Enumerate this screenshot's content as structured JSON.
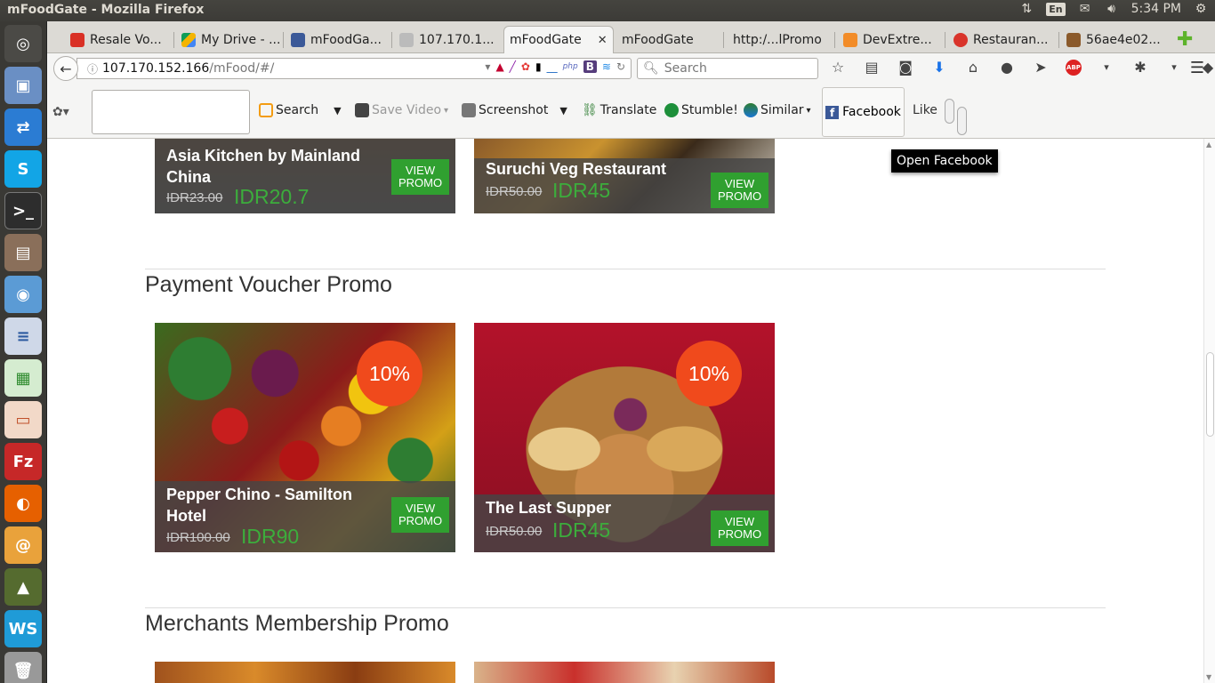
{
  "os": {
    "window_title": "mFoodGate - Mozilla Firefox",
    "lang": "En",
    "time": "5:34 PM"
  },
  "tabs": [
    {
      "label": "Resale Vo...",
      "color": "#d93025"
    },
    {
      "label": "My Drive - ...",
      "color": "#f4b400"
    },
    {
      "label": "mFoodGa...",
      "color": "#3b5998"
    },
    {
      "label": "107.170.1...",
      "color": "#6b6b6b"
    },
    {
      "label": "mFoodGate",
      "active": true
    },
    {
      "label": "mFoodGate",
      "color": ""
    },
    {
      "label": "http:/...lPromo",
      "color": ""
    },
    {
      "label": "DevExtre...",
      "color": "#f28c28"
    },
    {
      "label": "Restauran...",
      "color": "#d9342b"
    },
    {
      "label": "56ae4e02...",
      "color": "#8b5a2b"
    }
  ],
  "navbar": {
    "url_host": "107.170.152.166",
    "url_path": "/mFood/#/",
    "search_placeholder": "Search"
  },
  "addons": {
    "search": "Search",
    "save_video": "Save Video",
    "screenshot": "Screenshot",
    "translate": "Translate",
    "stumble": "Stumble!",
    "similar": "Similar",
    "facebook": "Facebook",
    "like": "Like"
  },
  "tooltip": "Open Facebook",
  "sections": [
    {
      "title": "Payment Voucher Promo"
    },
    {
      "title": "Merchants Membership Promo"
    }
  ],
  "cards_top": [
    {
      "name": "Asia Kitchen by Mainland China",
      "old_price": "IDR23.00",
      "new_price": "IDR20.7",
      "button": "VIEW PROMO"
    },
    {
      "name": "Suruchi Veg Restaurant",
      "old_price": "IDR50.00",
      "new_price": "IDR45",
      "button": "VIEW PROMO"
    }
  ],
  "cards_mid": [
    {
      "name": "Pepper Chino - Samilton Hotel",
      "old_price": "IDR100.00",
      "new_price": "IDR90",
      "badge": "10%",
      "button": "VIEW PROMO"
    },
    {
      "name": "The Last Supper",
      "old_price": "IDR50.00",
      "new_price": "IDR45",
      "badge": "10%",
      "button": "VIEW PROMO"
    }
  ],
  "colors": {
    "accent_green": "#30a030",
    "badge_orange": "#f04a1c",
    "price_green": "#3cad3c"
  }
}
